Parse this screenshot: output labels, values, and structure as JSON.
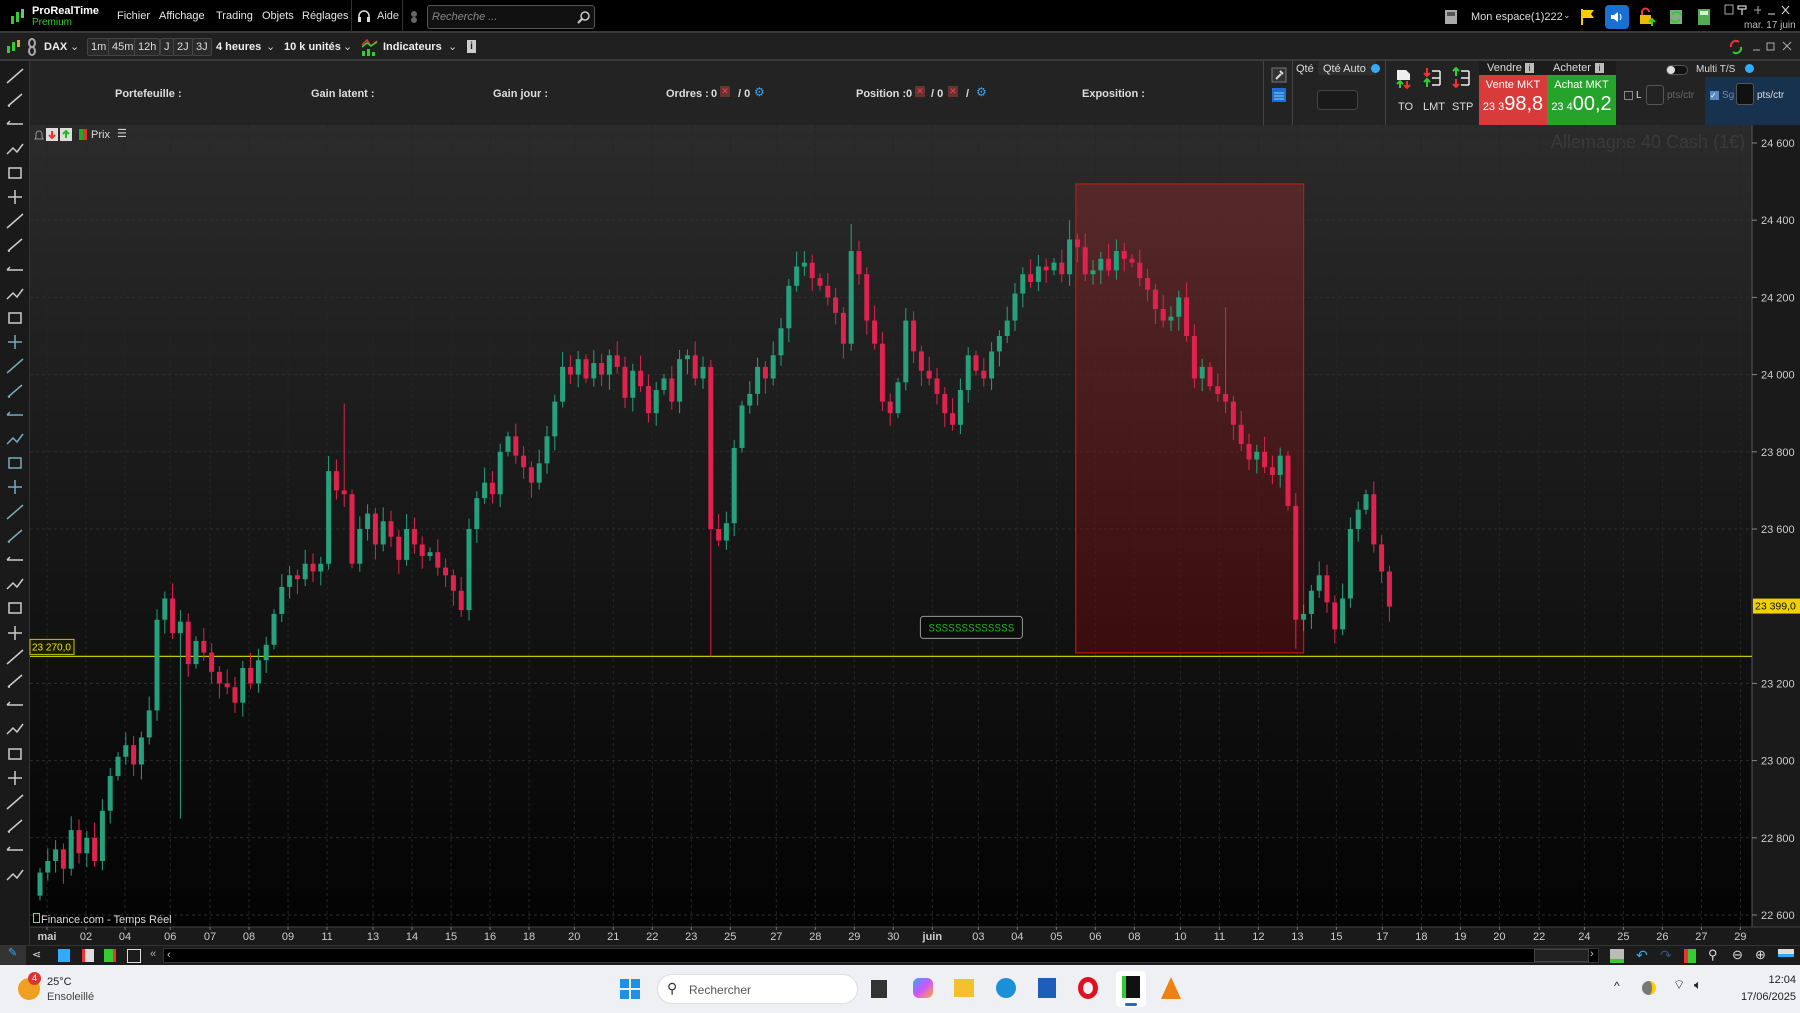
{
  "app": {
    "name": "ProRealTime",
    "edition": "Premium"
  },
  "menu": [
    "Fichier",
    "Affichage",
    "Trading",
    "Objets",
    "Réglages"
  ],
  "help_label": "Aide",
  "search": {
    "placeholder": "Recherche ..."
  },
  "workspace": "Mon espace(1)222",
  "header_date": "mar. 17 juin",
  "toolbar": {
    "instrument": "DAX",
    "timeframes": [
      "1m",
      "45m",
      "12h",
      "J",
      "2J",
      "3J"
    ],
    "period": "4 heures",
    "units": "10 k unités",
    "indicators": "Indicateurs"
  },
  "account": {
    "portefeuille": "Portefeuille :",
    "gain_latent": "Gain latent :",
    "gain_jour": "Gain jour :",
    "ordres": "Ordres :",
    "ordres_a": "0",
    "ordres_b": "/ 0",
    "position": "Position :",
    "position_a": "0",
    "position_b": "/ 0",
    "position_c": "/",
    "exposition": "Exposition :"
  },
  "trade": {
    "qte": "Qté",
    "qte_auto": "Qté Auto",
    "to": "TO",
    "lmt": "LMT",
    "stp": "STP",
    "vendre": "Vendre",
    "acheter": "Acheter",
    "sell_label": "Vente MKT",
    "sell_prefix": "23 3",
    "sell_main": "98,8",
    "buy_label": "Achat MKT",
    "buy_prefix": "23 4",
    "buy_main": "00,2",
    "multi": "Multi T/S",
    "l": "L",
    "ptsctr": "pts/ctr",
    "sg": "Sg",
    "ptsctr2": "pts/ctr"
  },
  "chart_header": {
    "price_label": "Prix"
  },
  "chart_data": {
    "type": "candlestick",
    "title": "Allemagne 40 Cash (1€)",
    "source": "Finance.com - Temps Réel",
    "ylim": [
      22600,
      24600
    ],
    "yticks": [
      "24 600",
      "24 400",
      "24 200",
      "24 000",
      "23 800",
      "23 600",
      "23 200",
      "23 000",
      "22 800",
      "22 600"
    ],
    "ytick_values": [
      24600,
      24400,
      24200,
      24000,
      23800,
      23600,
      23200,
      23000,
      22800,
      22600
    ],
    "last_price": 23399.0,
    "last_price_label": "23 399,0",
    "hline": {
      "value": 23270,
      "label": "23 270,0",
      "color": "#c8c800"
    },
    "first_open": 22650,
    "default_wick": 30,
    "closes": [
      22710,
      22740,
      22770,
      22720,
      22820,
      22760,
      22800,
      22740,
      22870,
      22960,
      23010,
      23040,
      22990,
      23060,
      23130,
      23365,
      23420,
      23330,
      23360,
      23250,
      23310,
      23280,
      23230,
      23200,
      23190,
      23150,
      23240,
      23200,
      23260,
      23300,
      23380,
      23450,
      23480,
      23470,
      23510,
      23490,
      23510,
      23750,
      23700,
      23690,
      23510,
      23600,
      23640,
      23560,
      23620,
      23580,
      23520,
      23600,
      23560,
      23530,
      23540,
      23500,
      23480,
      23440,
      23390,
      23600,
      23680,
      23720,
      23690,
      23800,
      23840,
      23790,
      23760,
      23720,
      23770,
      23840,
      23930,
      24020,
      24000,
      24040,
      23990,
      24030,
      24000,
      24050,
      24020,
      23940,
      24010,
      23970,
      23900,
      23960,
      23990,
      23930,
      24040,
      24050,
      23990,
      24020,
      23600,
      23570,
      23615,
      23810,
      23920,
      23950,
      24020,
      23990,
      24050,
      24120,
      24230,
      24280,
      24290,
      24250,
      24230,
      24200,
      24160,
      24080,
      24320,
      24260,
      24140,
      24080,
      23930,
      23900,
      23980,
      24140,
      24060,
      24010,
      23990,
      23950,
      23900,
      23870,
      23960,
      24050,
      24010,
      23990,
      24060,
      24100,
      24140,
      24210,
      24260,
      24240,
      24280,
      24270,
      24290,
      24260,
      24350,
      24330,
      24260,
      24270,
      24300,
      24270,
      24320,
      24300,
      24290,
      24250,
      24220,
      24170,
      24140,
      24150,
      24200,
      24100,
      23990,
      24020,
      23970,
      23950,
      23930,
      23870,
      23820,
      23780,
      23800,
      23760,
      23740,
      23790,
      23660,
      23365,
      23380,
      23440,
      23480,
      23410,
      23340,
      23420,
      23600,
      23650,
      23690,
      23560,
      23490,
      23399
    ],
    "wick_overrides": [
      {
        "i": 18,
        "low": 22850
      },
      {
        "i": 39,
        "high": 23925
      },
      {
        "i": 86,
        "low": 23270
      },
      {
        "i": 104,
        "high": 24390
      },
      {
        "i": 132,
        "high": 24400
      },
      {
        "i": 152,
        "high": 24175
      },
      {
        "i": 161,
        "low": 23290
      }
    ],
    "xticks": [
      {
        "label": "mai",
        "at": 0.9
      },
      {
        "label": "02",
        "at": 5.9
      },
      {
        "label": "04",
        "at": 10.9
      },
      {
        "label": "06",
        "at": 16.7
      },
      {
        "label": "07",
        "at": 21.8
      },
      {
        "label": "08",
        "at": 26.8
      },
      {
        "label": "09",
        "at": 31.8
      },
      {
        "label": "11",
        "at": 36.8
      },
      {
        "label": "13",
        "at": 42.7
      },
      {
        "label": "14",
        "at": 47.7
      },
      {
        "label": "15",
        "at": 52.7
      },
      {
        "label": "16",
        "at": 57.7
      },
      {
        "label": "18",
        "at": 62.7
      },
      {
        "label": "20",
        "at": 68.5
      },
      {
        "label": "21",
        "at": 73.5
      },
      {
        "label": "22",
        "at": 78.5
      },
      {
        "label": "23",
        "at": 83.5
      },
      {
        "label": "25",
        "at": 88.5
      },
      {
        "label": "27",
        "at": 94.4
      },
      {
        "label": "28",
        "at": 99.4
      },
      {
        "label": "29",
        "at": 104.4
      },
      {
        "label": "30",
        "at": 109.4
      },
      {
        "label": "juin",
        "at": 114.4
      },
      {
        "label": "03",
        "at": 120.3
      },
      {
        "label": "04",
        "at": 125.3
      },
      {
        "label": "05",
        "at": 130.3
      },
      {
        "label": "06",
        "at": 135.3
      },
      {
        "label": "08",
        "at": 140.3
      },
      {
        "label": "10",
        "at": 146.2
      },
      {
        "label": "11",
        "at": 151.2
      },
      {
        "label": "12",
        "at": 156.2
      },
      {
        "label": "13",
        "at": 161.2
      },
      {
        "label": "15",
        "at": 166.2
      },
      {
        "label": "17",
        "at": 172.1
      },
      {
        "label": "18",
        "at": 177.1
      },
      {
        "label": "19",
        "at": 182.1
      },
      {
        "label": "20",
        "at": 187.1
      },
      {
        "label": "22",
        "at": 192.2
      },
      {
        "label": "24",
        "at": 198
      },
      {
        "label": "25",
        "at": 203
      },
      {
        "label": "26",
        "at": 208
      },
      {
        "label": "27",
        "at": 213
      },
      {
        "label": "29",
        "at": 218
      }
    ],
    "zone": {
      "from": 132.8,
      "to": 162,
      "top": 24494,
      "bottom": 23279,
      "color": "#cc1010"
    },
    "note": {
      "text": "SSSSSSSSSSSSS",
      "at": 113,
      "value": 23345
    },
    "colors": {
      "up": "#26a17b",
      "down": "#e0234e"
    }
  },
  "taskbar": {
    "weather_badge": "4",
    "temp": "25°C",
    "weather": "Ensoleillé",
    "search": "Rechercher",
    "time": "12:04",
    "date": "17/06/2025"
  }
}
